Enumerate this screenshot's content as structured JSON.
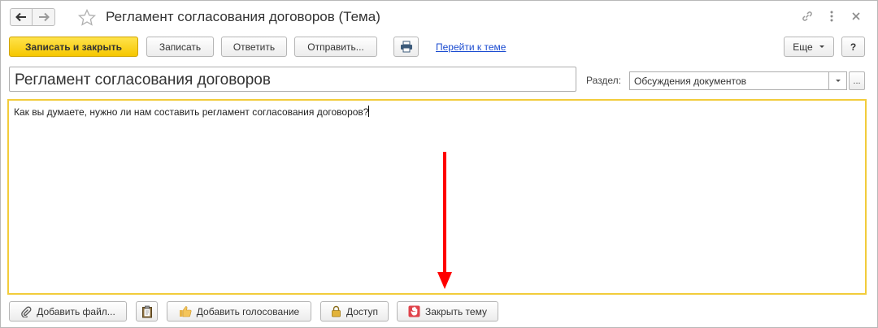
{
  "window": {
    "title": "Регламент согласования договоров (Тема)"
  },
  "nav": {
    "back_icon": "arrow-left-icon",
    "forward_icon": "arrow-right-icon",
    "favorite_icon": "star-icon"
  },
  "window_icons": [
    "link-icon",
    "more-vertical-icon",
    "close-icon"
  ],
  "toolbar": {
    "save_close_label": "Записать и закрыть",
    "save_label": "Записать",
    "reply_label": "Ответить",
    "send_label": "Отправить...",
    "print_icon": "printer-icon",
    "goto_topic_label": "Перейти к теме",
    "more_label": "Еще",
    "help_label": "?"
  },
  "form": {
    "subject_value": "Регламент согласования договоров",
    "section_label": "Раздел:",
    "section_value": "Обсуждения документов",
    "section_dropdown_icon": "chevron-down-icon",
    "section_select_label": "...",
    "body_text": "Как вы думаете, нужно ли нам составить регламент согласования договоров?"
  },
  "bottom_toolbar": {
    "add_file_label": "Добавить файл...",
    "paste_icon": "clipboard-icon",
    "add_vote_label": "Добавить голосование",
    "access_label": "Доступ",
    "close_topic_label": "Закрыть тему"
  },
  "colors": {
    "primary_button": "#f6c700",
    "focus_border": "#f2cc3b",
    "link": "#1a4bd0",
    "annotation_arrow": "#ff0000"
  }
}
